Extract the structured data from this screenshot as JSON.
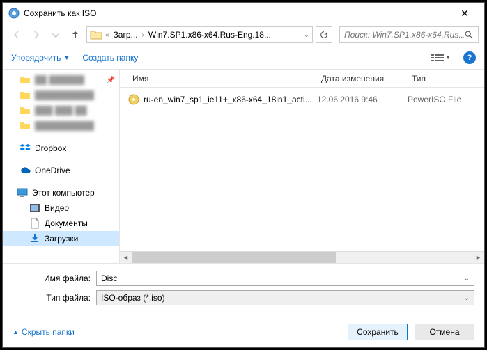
{
  "title": "Сохранить как ISO",
  "breadcrumb": {
    "c1": "Загр...",
    "c2": "Win7.SP1.x86-x64.Rus-Eng.18..."
  },
  "search_placeholder": "Поиск: Win7.SP1.x86-x64.Rus...",
  "toolbar": {
    "organize": "Упорядочить",
    "newfolder": "Создать папку"
  },
  "columns": {
    "name": "Имя",
    "date": "Дата изменения",
    "type": "Тип"
  },
  "sidebar": {
    "blur1": "██ ██████",
    "blur2": "██████████",
    "blur3": "███ ███ ██",
    "blur4": "██████████",
    "dropbox": "Dropbox",
    "onedrive": "OneDrive",
    "thispc": "Этот компьютер",
    "videos": "Видео",
    "documents": "Документы",
    "downloads": "Загрузки"
  },
  "file": {
    "name": "ru-en_win7_sp1_ie11+_x86-x64_18in1_acti...",
    "date": "12.06.2016 9:46",
    "type": "PowerISO File"
  },
  "form": {
    "filename_label": "Имя файла:",
    "filename_value": "Disc",
    "filetype_label": "Тип файла:",
    "filetype_value": "ISO-образ (*.iso)"
  },
  "footer": {
    "hide": "Скрыть папки",
    "save": "Сохранить",
    "cancel": "Отмена"
  }
}
